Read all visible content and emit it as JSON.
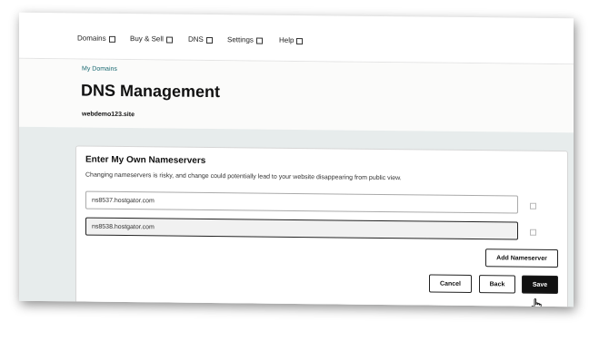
{
  "nav": [
    {
      "label": "Domains"
    },
    {
      "label": "Buy & Sell"
    },
    {
      "label": "DNS"
    },
    {
      "label": "Settings"
    },
    {
      "label": "Help"
    }
  ],
  "header": {
    "breadcrumb": "My Domains",
    "title": "DNS Management",
    "domain": "webdemo123.site"
  },
  "nameservers_card": {
    "title": "Enter My Own Nameservers",
    "description": "Changing nameservers is risky, and change could potentially lead to your website disappearing from public view.",
    "nameservers": [
      {
        "value": "ns8537.hostgator.com"
      },
      {
        "value": "ns8538.hostgator.com"
      }
    ],
    "add_label": "Add Nameserver",
    "cancel_label": "Cancel",
    "back_label": "Back",
    "save_label": "Save"
  },
  "icons": {
    "cursor": "hand-pointer-icon",
    "nav_chevron": "chevron-down-icon",
    "remove": "remove-icon"
  },
  "colors": {
    "breadcrumb": "#1b6a72",
    "primary_button": "#111111",
    "content_bg": "#e7ecec"
  }
}
